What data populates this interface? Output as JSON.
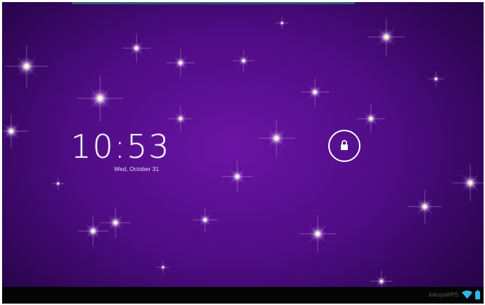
{
  "lockscreen": {
    "time": "10:53",
    "date": "Wed, October 31",
    "unlock_icon": "lock-icon"
  },
  "status_bar": {
    "network_name": "linksysWPS",
    "wifi_icon": "wifi-icon",
    "battery_icon": "battery-icon"
  },
  "colors": {
    "background": "#4e0c84",
    "navbar": "#050505",
    "clock_text": "#ffffff",
    "status_icons": "#33b5e5"
  }
}
